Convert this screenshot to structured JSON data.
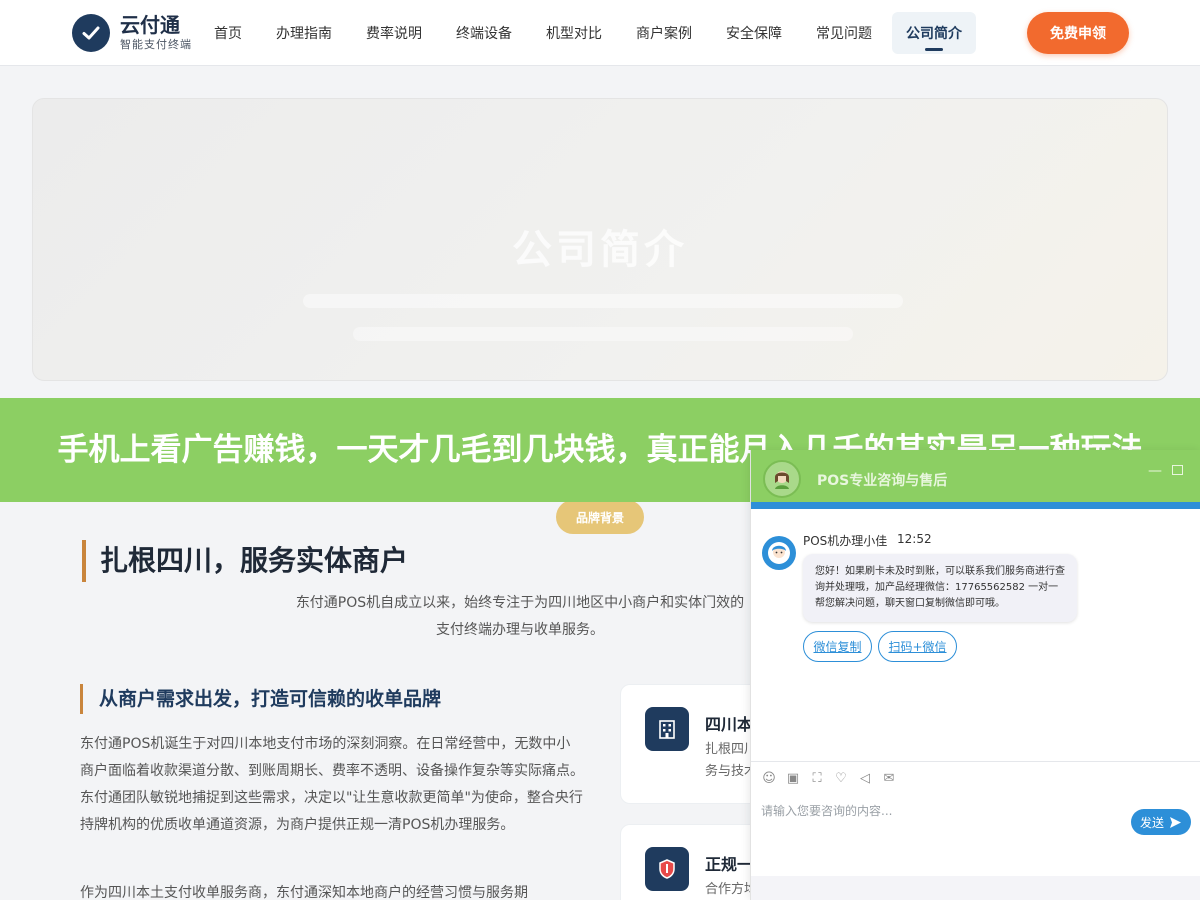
{
  "brand": {
    "name": "云付通",
    "tagline": "智能支付终端"
  },
  "nav": {
    "items": [
      "首页",
      "办理指南",
      "费率说明",
      "终端设备",
      "机型对比",
      "商户案例",
      "安全保障",
      "常见问题",
      "公司简介"
    ],
    "active": "公司简介",
    "cta": "免费申领"
  },
  "banner": {
    "title": "公司简介"
  },
  "article": {
    "headline": "手机上看广告赚钱，一天才几毛到几块钱，真正能月入几千的其实是另一种玩法"
  },
  "section": {
    "badge": "品牌背景",
    "title": "扎根四川，服务实体商户",
    "desc": "东付通POS机自成立以来，始终专注于为四川地区中小商户和实体门效的支付终端办理与收单服务。",
    "subtitle": "从商户需求出发，打造可信赖的收单品牌",
    "para1": "东付通POS机诞生于对四川本地支付市场的深刻洞察。在日常经营中，无数中小商户面临着收款渠道分散、到账周期长、费率不透明、设备操作复杂等实际痛点。东付通团队敏锐地捕捉到这些需求，决定以\"让生意收款更简单\"为使命，整合央行持牌机构的优质收单通道资源，为商户提供正规一清POS机办理服务。",
    "para2": "作为四川本土支付收单服务商，东付通深知本地商户的经营习惯与服务期"
  },
  "cards": [
    {
      "title": "四川本",
      "text": "扎根四川务与技术"
    },
    {
      "title": "正规一",
      "text": "合作方均"
    }
  ],
  "chat": {
    "header_title": "POS专业咨询与售后",
    "agent_name": "POS机办理小佳",
    "time": "12:52",
    "message": "您好！如果刷卡未及时到账，可以联系我们服务商进行查询并处理哦，加产品经理微信：17765562582 一对一帮您解决问题，聊天窗口复制微信即可哦。",
    "quick_buttons": [
      "微信复制",
      "扫码+微信"
    ],
    "input_placeholder": "请输入您要咨询的内容...",
    "send_label": "发送",
    "minimize_label": "—"
  },
  "colors": {
    "brand_navy": "#1f3b5e",
    "cta_orange": "#f26a2e",
    "headline_green": "#8ccf63",
    "chat_blue": "#2d8fd8",
    "accent_gold": "#c9853c"
  }
}
